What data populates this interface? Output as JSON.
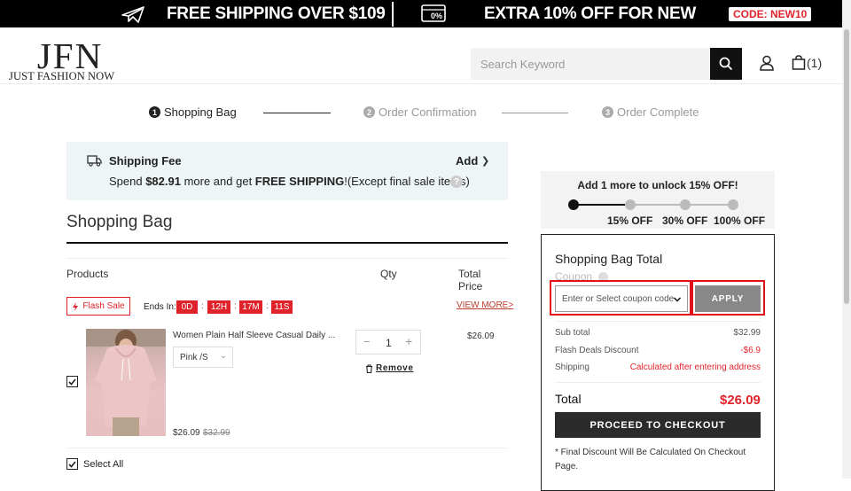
{
  "banner": {
    "shipping_text": "FREE SHIPPING OVER $109",
    "discount_text": "EXTRA 10% OFF FOR NEW",
    "code_text": "CODE: NEW10",
    "plane_icon": "plane-icon",
    "tag_icon": "percent-tag-icon"
  },
  "header": {
    "logo_big": "JFN",
    "logo_small": "JUST FASHION NOW",
    "search_placeholder": "Search Keyword",
    "cart_count": "(1)"
  },
  "steps": [
    {
      "num": "1",
      "label": "Shopping Bag",
      "state": "active"
    },
    {
      "num": "2",
      "label": "Order Confirmation",
      "state": "inactive"
    },
    {
      "num": "3",
      "label": "Order Complete",
      "state": "inactive"
    }
  ],
  "shipping": {
    "title": "Shipping Fee",
    "add": "Add",
    "msg_prefix": "Spend ",
    "amount": "$82.91",
    "msg_mid": " more and get ",
    "free": "FREE SHIPPING",
    "msg_suffix": "!(Except final sale items)"
  },
  "bag": {
    "title": "Shopping Bag",
    "col_products": "Products",
    "col_qty": "Qty",
    "col_total": "Total Price",
    "flash_sale": "Flash Sale",
    "ends_in": "Ends In:",
    "timer": [
      "0D",
      "12H",
      "17M",
      "11S"
    ],
    "view_more": "VIEW MORE>",
    "item": {
      "name": "Women Plain Half Sleeve Casual Daily ...",
      "variant": "Pink /S",
      "qty": "1",
      "price": "$26.09",
      "old_price": "$32.99",
      "total": "$26.09",
      "remove": "Remove",
      "checked": true
    },
    "select_all": "Select All"
  },
  "promo": {
    "title": "Add 1 more to unlock 15% OFF!",
    "tiers": [
      "15% OFF",
      "30% OFF",
      "100% OFF"
    ],
    "progress": 0.333
  },
  "summary": {
    "title": "Shopping Bag Total",
    "coupon_label": "Coupon",
    "coupon_placeholder": "Enter or Select coupon code",
    "apply": "APPLY",
    "subtotal_label": "Sub total",
    "subtotal": "$32.99",
    "discount_label": "Flash Deals Discount",
    "discount": "-$6.9",
    "shipping_label": "Shipping",
    "shipping_value": "Calculated after entering address",
    "total_label": "Total",
    "total": "$26.09",
    "checkout": "PROCEED TO CHECKOUT",
    "note": "* Final Discount Will Be Calculated On Checkout Page."
  },
  "colors": {
    "accent_red": "#e0232b",
    "dark": "#111111",
    "highlight": "#e0111b"
  }
}
